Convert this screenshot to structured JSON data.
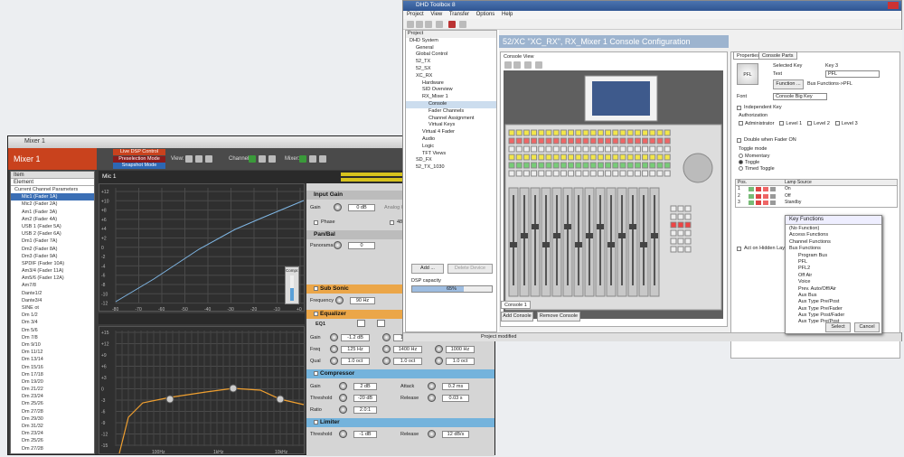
{
  "mixer": {
    "title": "Mixer 1",
    "name": "Mixer 1",
    "modes": [
      "Live DSP Control",
      "Preselection Mode",
      "Snapshot Mode"
    ],
    "view_label": "View:",
    "channel_label": "Channel:",
    "mixer_label": "Mixer:",
    "tree_header": "Item",
    "tree_col": "Element",
    "tree_group": "Current Channel Parameters",
    "tree_items": [
      "Mic1 (Fader 1A)",
      "Mic2 (Fader 2A)",
      "Am1 (Fader 3A)",
      "Am2 (Fader 4A)",
      "USB 1 (Fader 5A)",
      "USB 2 (Fader 6A)",
      "Dm1 (Fader 7A)",
      "Dm2 (Fader 8A)",
      "Dm3 (Fader 9A)",
      "SPDIF (Fader 10A)",
      "Am3/4 (Fader 11A)",
      "Am5/6 (Fader 12A)",
      "Am7/8",
      "Dante1/2",
      "Dante3/4",
      "SINE ot",
      "Dm 1/2",
      "Dm 3/4",
      "Dm 5/6",
      "Dm 7/8",
      "Dm 9/10",
      "Dm 11/12",
      "Dm 13/14",
      "Dm 15/16",
      "Dm 17/18",
      "Dm 19/20",
      "Dm 21/22",
      "Dm 23/24",
      "Dm 25/26",
      "Dm 27/28",
      "Dm 29/30",
      "Dm 31/32",
      "Dm 23/24",
      "Dm 25/26",
      "Dm 27/28",
      "Dm 29/40",
      "Dm 41/42"
    ],
    "channel_title": "Mic 1",
    "meter_labels": [
      "-40",
      "-30",
      "-20",
      "-10",
      "0"
    ],
    "graph1_x": [
      "-80",
      "-70",
      "-60",
      "-50",
      "-40",
      "-30",
      "-20",
      "-10",
      "+0"
    ],
    "graph1_y": [
      "+12",
      "+10",
      "+8",
      "+6",
      "+4",
      "+2",
      "0",
      "-2",
      "-4",
      "-6",
      "-8",
      "-10",
      "-12"
    ],
    "graph2_y": [
      "+15",
      "+12",
      "+9",
      "+6",
      "+3",
      "0",
      "-3",
      "-6",
      "-9",
      "-12",
      "-15"
    ],
    "graph2_x": [
      "100Hz",
      "1kHz",
      "10kHz"
    ],
    "compr_label": "Compr.",
    "input_gain": {
      "title": "Input Gain",
      "gain_label": "Gain",
      "gain_value": "0 dB",
      "analog_label": "Analog Gain",
      "phase_label": "Phase",
      "dB48": "48"
    },
    "pan_bal": {
      "title": "Pan/Bal",
      "pan_label": "Panorama",
      "pan_value": "0"
    },
    "sub_sonic": {
      "title": "Sub Sonic",
      "freq_label": "Frequency",
      "freq_value": "90 Hz"
    },
    "equalizer": {
      "title": "Equalizer",
      "eq_label": "EQ1",
      "gain_label": "Gain",
      "freq_label": "Freq",
      "qual_label": "Qual",
      "gains": [
        "-1.2 dB",
        "1.5 dB",
        "1.5 dB"
      ],
      "freqs": [
        "125 Hz",
        "1400 Hz",
        "1000 Hz"
      ],
      "quals": [
        "1.0 oct",
        "1.0 oct",
        "1.0 oct"
      ]
    },
    "compressor": {
      "title": "Compressor",
      "gain_label": "Gain",
      "gain_value": "2 dB",
      "attack_label": "Attack",
      "attack_value": "0.2 ms",
      "threshold_label": "Threshold",
      "threshold_value": "-20 dB",
      "release_label": "Release",
      "release_value": "0.03 s",
      "ratio_label": "Ratio",
      "ratio_value": "2.0:1"
    },
    "limiter": {
      "title": "Limiter",
      "threshold_label": "Threshold",
      "threshold_value": "-1 dB",
      "release_label": "Release",
      "release_value": "12 dB/s"
    }
  },
  "dhd": {
    "title": "DHD Toolbox 8",
    "menu": [
      "Project",
      "View",
      "Transfer",
      "Options",
      "Help"
    ],
    "project_label": "Project",
    "tree": [
      "DHD System",
      "General",
      "Global Control",
      "52_TX",
      "52_SX",
      "XC_RX",
      "Hardware",
      "SID Overview",
      "RX_Mixer 1",
      "Console",
      "Fader Channels",
      "Channel Assignment",
      "Virtual Keys",
      "Virtual 4 Fader",
      "Audio",
      "Logic",
      "TFT Views",
      "SD_FX",
      "52_TX_1030"
    ],
    "add_btn": "Add ...",
    "delete_btn": "Delete Device",
    "dsp_label": "DSP capacity",
    "dsp_value": "65%",
    "dsp_fraction": 0.65,
    "config_title": "52/XC \"XC_RX\", RX_Mixer 1 Console Configuration",
    "console_view": "Console View",
    "console_tab": "Console 1",
    "add_console": "Add Console",
    "remove_console": "Remove Console",
    "prop_tabs": [
      "Properties",
      "Console Parts"
    ],
    "key_text": "PFL",
    "selected_key_label": "Selected Key",
    "selected_key_value": "Key 3",
    "text_label": "Text",
    "text_value": "PFL",
    "function_btn": "Function ...",
    "function_value": "Bus Functions->PFL",
    "font_label": "Font",
    "font_value": "Console Big Key",
    "independent_key": "Independent Key",
    "authorization": "Authorization",
    "auth_items": [
      "Administrator",
      "Level 1",
      "Level 2",
      "Level 3"
    ],
    "double_when": "Double when Fader ON",
    "toggle_mode": "Toggle mode",
    "toggle_items": [
      "Momentary",
      "Toggle",
      "Timed Toggle"
    ],
    "table_headers": [
      "Pos.",
      "Lamp Source"
    ],
    "table_rows": [
      {
        "pos": "1",
        "src": "On"
      },
      {
        "pos": "2",
        "src": "Off"
      },
      {
        "pos": "3",
        "src": "Standby"
      }
    ],
    "act_hidden": "Act on Hidden Layer",
    "keyfn_title": "Key Functions",
    "keyfn_items": [
      "(No Function)",
      "Access Functions",
      "Channel Functions",
      "Bus Functions",
      "Program Bus",
      "PFL",
      "PFL2",
      "Off Air",
      "Voice",
      "Prev. Auto/Off/Air",
      "Aux Bus",
      "Aux Type Pre/Post",
      "Aux Type Pre/Fader",
      "Aux Type Post/Fader",
      "Aux Type Pre/Post"
    ],
    "select_btn": "Select",
    "cancel_btn": "Cancel",
    "status": "Project modified"
  }
}
